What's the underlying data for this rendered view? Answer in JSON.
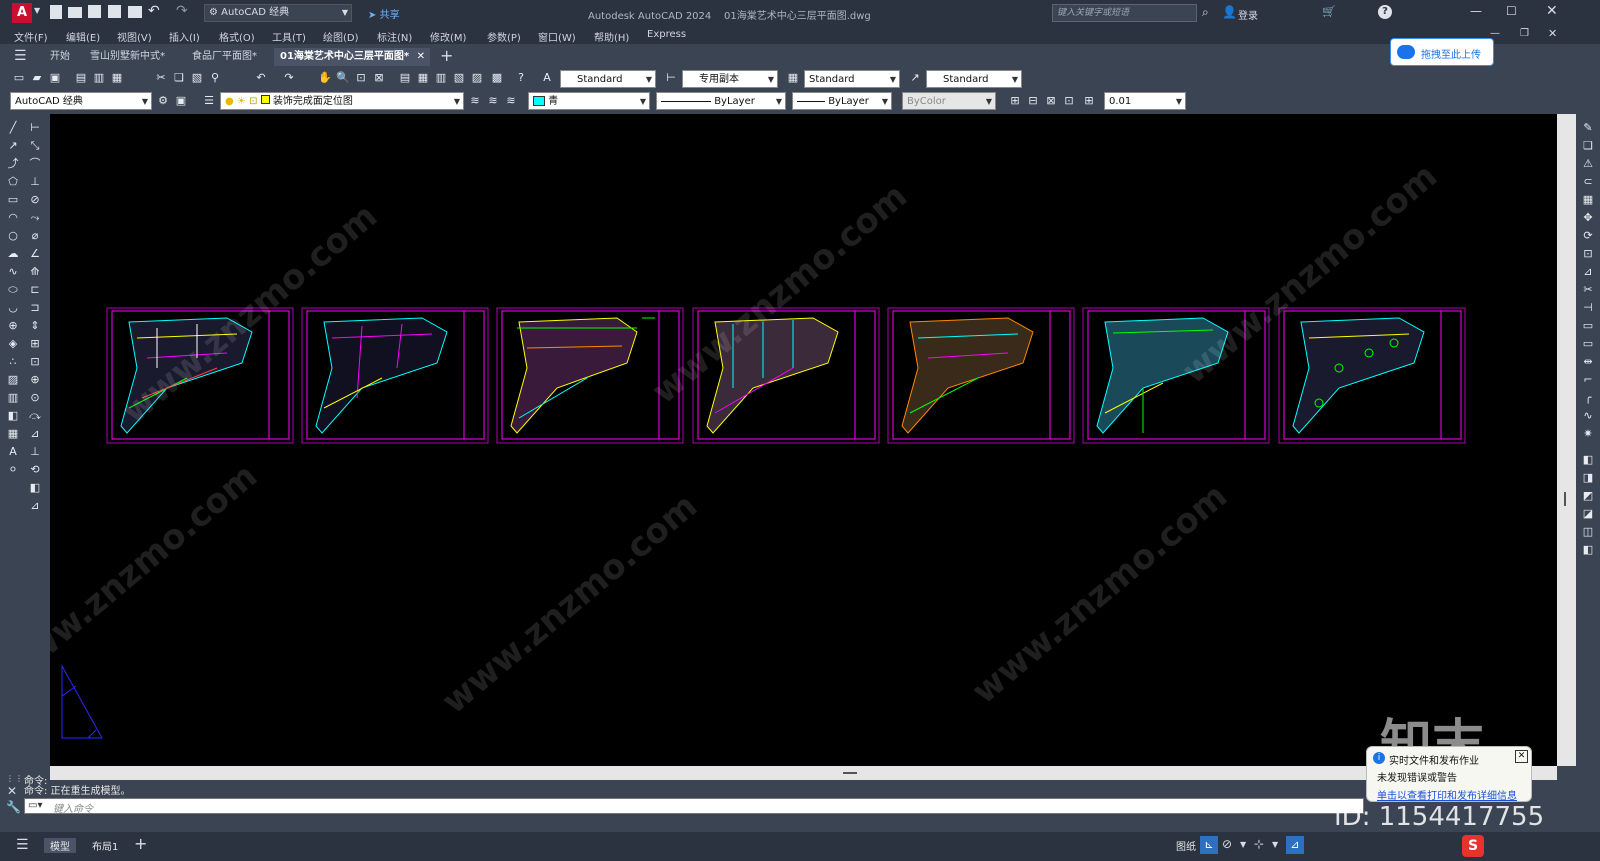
{
  "titlebar": {
    "app_logo": "A",
    "workspace": "AutoCAD 经典",
    "share": "共享",
    "title": "Autodesk AutoCAD 2024    01海棠艺术中心三层平面图.dwg",
    "search_placeholder": "键入关键字或短语",
    "login": "登录"
  },
  "menu": [
    "文件(F)",
    "编辑(E)",
    "视图(V)",
    "插入(I)",
    "格式(O)",
    "工具(T)",
    "绘图(D)",
    "标注(N)",
    "修改(M)",
    "参数(P)",
    "窗口(W)",
    "帮助(H)",
    "Express"
  ],
  "tabs": [
    "开始",
    "雪山别墅新中式*",
    "食品厂平面图*",
    "01海棠艺术中心三层平面图*"
  ],
  "upload_button": "拖拽至此上传",
  "toolbar1": {
    "text_style": "Standard",
    "dim_style": "专用副本",
    "table_style": "Standard",
    "multileader_style": "Standard"
  },
  "toolbar2": {
    "workspace": "AutoCAD 经典",
    "layer": "装饰完成面定位图",
    "color": "青",
    "linetype": "ByLayer",
    "lineweight": "ByLayer",
    "plotstyle": "ByColor",
    "scale": "0.01"
  },
  "command": {
    "line1": "命令:",
    "line2": "命令: 正在重生成模型。",
    "input_placeholder": "键入命令"
  },
  "status": {
    "model_tab": "模型",
    "layout_tab": "布局1",
    "paper": "图纸"
  },
  "notification": {
    "title": "实时文件和发布作业",
    "body": "未发现错误或警告",
    "link": "单击以查看打印和发布详细信息"
  },
  "watermark": {
    "text": "www.znzmo.com",
    "brand": "知末",
    "id": "ID: 1154417755"
  },
  "colors": {
    "frame": "#c800c8",
    "canvas": "#000000",
    "accent": "#1a73e8"
  }
}
